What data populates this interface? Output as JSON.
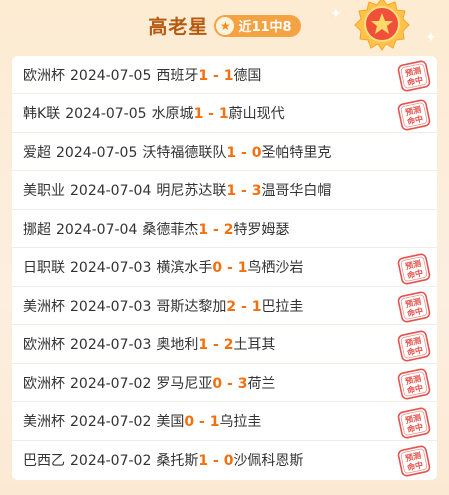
{
  "header": {
    "title": "高老星",
    "badge": "近11中8"
  },
  "stamp_text": {
    "line1": "预测",
    "line2": "命中"
  },
  "matches": [
    {
      "league": "欧洲杯",
      "date": "2024-07-05",
      "home": "西班牙",
      "hs": "1",
      "sep": " - ",
      "as": "1",
      "away": "德国",
      "hit": true
    },
    {
      "league": "韩K联",
      "date": "2024-07-05",
      "home": "水原城",
      "hs": "1",
      "sep": " - ",
      "as": "1",
      "away": "蔚山现代",
      "hit": true
    },
    {
      "league": "爱超",
      "date": "2024-07-05",
      "home": "沃特福德联队",
      "hs": "1",
      "sep": " - ",
      "as": "0",
      "away": "圣帕特里克",
      "hit": false
    },
    {
      "league": "美职业",
      "date": "2024-07-04",
      "home": "明尼苏达联",
      "hs": "1",
      "sep": " - ",
      "as": "3",
      "away": "温哥华白帽",
      "hit": false
    },
    {
      "league": "挪超",
      "date": "2024-07-04",
      "home": "桑德菲杰",
      "hs": "1",
      "sep": " - ",
      "as": "2",
      "away": "特罗姆瑟",
      "hit": false
    },
    {
      "league": "日职联",
      "date": "2024-07-03",
      "home": "横滨水手",
      "hs": "0",
      "sep": " - ",
      "as": "1",
      "away": "鸟栖沙岩",
      "hit": true
    },
    {
      "league": "美洲杯",
      "date": "2024-07-03",
      "home": "哥斯达黎加",
      "hs": "2",
      "sep": " - ",
      "as": "1",
      "away": "巴拉圭",
      "hit": true
    },
    {
      "league": "欧洲杯",
      "date": "2024-07-03",
      "home": "奥地利",
      "hs": "1",
      "sep": " - ",
      "as": "2",
      "away": "土耳其",
      "hit": true
    },
    {
      "league": "欧洲杯",
      "date": "2024-07-02",
      "home": "罗马尼亚",
      "hs": "0",
      "sep": " - ",
      "as": "3",
      "away": "荷兰",
      "hit": true
    },
    {
      "league": "美洲杯",
      "date": "2024-07-02",
      "home": "美国",
      "hs": "0",
      "sep": " - ",
      "as": "1",
      "away": "乌拉圭",
      "hit": true
    },
    {
      "league": "巴西乙",
      "date": "2024-07-02",
      "home": "桑托斯",
      "hs": "1",
      "sep": " - ",
      "as": "0",
      "away": "沙佩科恩斯",
      "hit": true
    }
  ],
  "colors": {
    "accent": "#f2700f",
    "title": "#b55a10",
    "badge": "#f5a243",
    "stamp": "#e2554f"
  },
  "icons": {
    "badge": "star-icon",
    "medal": "medal-icon",
    "stamp": "hit-stamp-icon"
  }
}
